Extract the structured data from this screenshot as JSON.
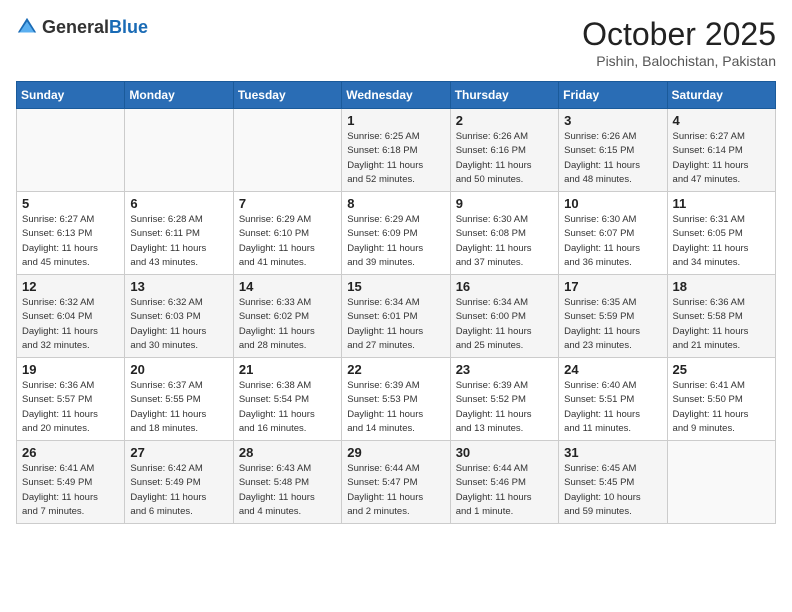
{
  "header": {
    "logo_general": "General",
    "logo_blue": "Blue",
    "month": "October 2025",
    "location": "Pishin, Balochistan, Pakistan"
  },
  "days_of_week": [
    "Sunday",
    "Monday",
    "Tuesday",
    "Wednesday",
    "Thursday",
    "Friday",
    "Saturday"
  ],
  "weeks": [
    [
      {
        "day": "",
        "info": ""
      },
      {
        "day": "",
        "info": ""
      },
      {
        "day": "",
        "info": ""
      },
      {
        "day": "1",
        "info": "Sunrise: 6:25 AM\nSunset: 6:18 PM\nDaylight: 11 hours\nand 52 minutes."
      },
      {
        "day": "2",
        "info": "Sunrise: 6:26 AM\nSunset: 6:16 PM\nDaylight: 11 hours\nand 50 minutes."
      },
      {
        "day": "3",
        "info": "Sunrise: 6:26 AM\nSunset: 6:15 PM\nDaylight: 11 hours\nand 48 minutes."
      },
      {
        "day": "4",
        "info": "Sunrise: 6:27 AM\nSunset: 6:14 PM\nDaylight: 11 hours\nand 47 minutes."
      }
    ],
    [
      {
        "day": "5",
        "info": "Sunrise: 6:27 AM\nSunset: 6:13 PM\nDaylight: 11 hours\nand 45 minutes."
      },
      {
        "day": "6",
        "info": "Sunrise: 6:28 AM\nSunset: 6:11 PM\nDaylight: 11 hours\nand 43 minutes."
      },
      {
        "day": "7",
        "info": "Sunrise: 6:29 AM\nSunset: 6:10 PM\nDaylight: 11 hours\nand 41 minutes."
      },
      {
        "day": "8",
        "info": "Sunrise: 6:29 AM\nSunset: 6:09 PM\nDaylight: 11 hours\nand 39 minutes."
      },
      {
        "day": "9",
        "info": "Sunrise: 6:30 AM\nSunset: 6:08 PM\nDaylight: 11 hours\nand 37 minutes."
      },
      {
        "day": "10",
        "info": "Sunrise: 6:30 AM\nSunset: 6:07 PM\nDaylight: 11 hours\nand 36 minutes."
      },
      {
        "day": "11",
        "info": "Sunrise: 6:31 AM\nSunset: 6:05 PM\nDaylight: 11 hours\nand 34 minutes."
      }
    ],
    [
      {
        "day": "12",
        "info": "Sunrise: 6:32 AM\nSunset: 6:04 PM\nDaylight: 11 hours\nand 32 minutes."
      },
      {
        "day": "13",
        "info": "Sunrise: 6:32 AM\nSunset: 6:03 PM\nDaylight: 11 hours\nand 30 minutes."
      },
      {
        "day": "14",
        "info": "Sunrise: 6:33 AM\nSunset: 6:02 PM\nDaylight: 11 hours\nand 28 minutes."
      },
      {
        "day": "15",
        "info": "Sunrise: 6:34 AM\nSunset: 6:01 PM\nDaylight: 11 hours\nand 27 minutes."
      },
      {
        "day": "16",
        "info": "Sunrise: 6:34 AM\nSunset: 6:00 PM\nDaylight: 11 hours\nand 25 minutes."
      },
      {
        "day": "17",
        "info": "Sunrise: 6:35 AM\nSunset: 5:59 PM\nDaylight: 11 hours\nand 23 minutes."
      },
      {
        "day": "18",
        "info": "Sunrise: 6:36 AM\nSunset: 5:58 PM\nDaylight: 11 hours\nand 21 minutes."
      }
    ],
    [
      {
        "day": "19",
        "info": "Sunrise: 6:36 AM\nSunset: 5:57 PM\nDaylight: 11 hours\nand 20 minutes."
      },
      {
        "day": "20",
        "info": "Sunrise: 6:37 AM\nSunset: 5:55 PM\nDaylight: 11 hours\nand 18 minutes."
      },
      {
        "day": "21",
        "info": "Sunrise: 6:38 AM\nSunset: 5:54 PM\nDaylight: 11 hours\nand 16 minutes."
      },
      {
        "day": "22",
        "info": "Sunrise: 6:39 AM\nSunset: 5:53 PM\nDaylight: 11 hours\nand 14 minutes."
      },
      {
        "day": "23",
        "info": "Sunrise: 6:39 AM\nSunset: 5:52 PM\nDaylight: 11 hours\nand 13 minutes."
      },
      {
        "day": "24",
        "info": "Sunrise: 6:40 AM\nSunset: 5:51 PM\nDaylight: 11 hours\nand 11 minutes."
      },
      {
        "day": "25",
        "info": "Sunrise: 6:41 AM\nSunset: 5:50 PM\nDaylight: 11 hours\nand 9 minutes."
      }
    ],
    [
      {
        "day": "26",
        "info": "Sunrise: 6:41 AM\nSunset: 5:49 PM\nDaylight: 11 hours\nand 7 minutes."
      },
      {
        "day": "27",
        "info": "Sunrise: 6:42 AM\nSunset: 5:49 PM\nDaylight: 11 hours\nand 6 minutes."
      },
      {
        "day": "28",
        "info": "Sunrise: 6:43 AM\nSunset: 5:48 PM\nDaylight: 11 hours\nand 4 minutes."
      },
      {
        "day": "29",
        "info": "Sunrise: 6:44 AM\nSunset: 5:47 PM\nDaylight: 11 hours\nand 2 minutes."
      },
      {
        "day": "30",
        "info": "Sunrise: 6:44 AM\nSunset: 5:46 PM\nDaylight: 11 hours\nand 1 minute."
      },
      {
        "day": "31",
        "info": "Sunrise: 6:45 AM\nSunset: 5:45 PM\nDaylight: 10 hours\nand 59 minutes."
      },
      {
        "day": "",
        "info": ""
      }
    ]
  ]
}
